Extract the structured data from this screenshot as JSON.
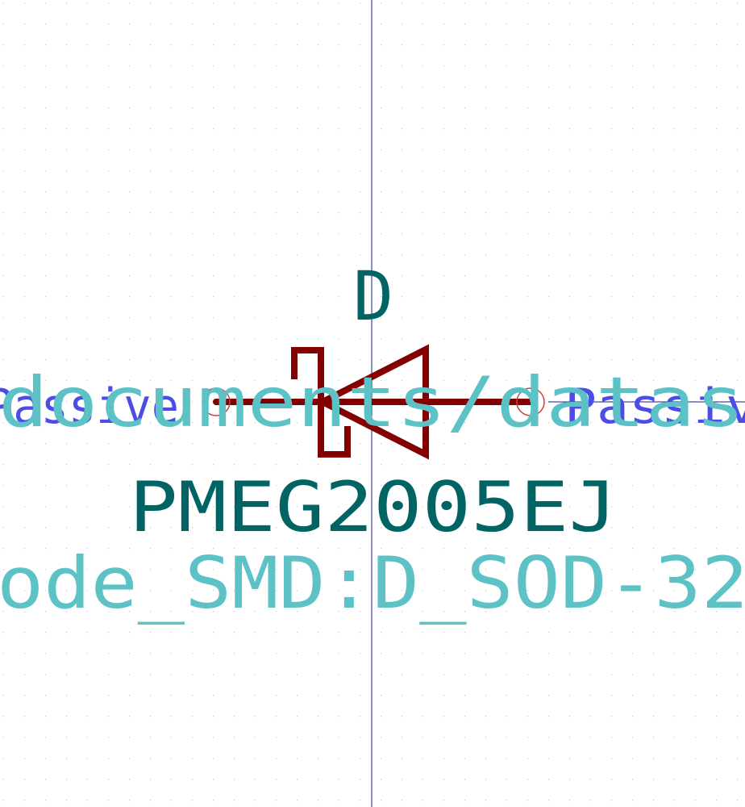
{
  "symbol": {
    "reference": "D",
    "value": "PMEG2005EJ",
    "footprint": "ode_SMD:D_SOD-32",
    "datasheet": "documents/datas",
    "pin_left_type": "Passive",
    "pin_right_type": "Passiv"
  },
  "colors": {
    "background": "#ffffff",
    "grid_dot": "#c8c8c8",
    "axis": "#1a1a8c",
    "body": "#840000",
    "pin_marker": "#c84040",
    "reference_text": "#006464",
    "value_text": "#006464",
    "field_text": "#5cc2c6",
    "pin_type_text": "#4c4ce6"
  }
}
